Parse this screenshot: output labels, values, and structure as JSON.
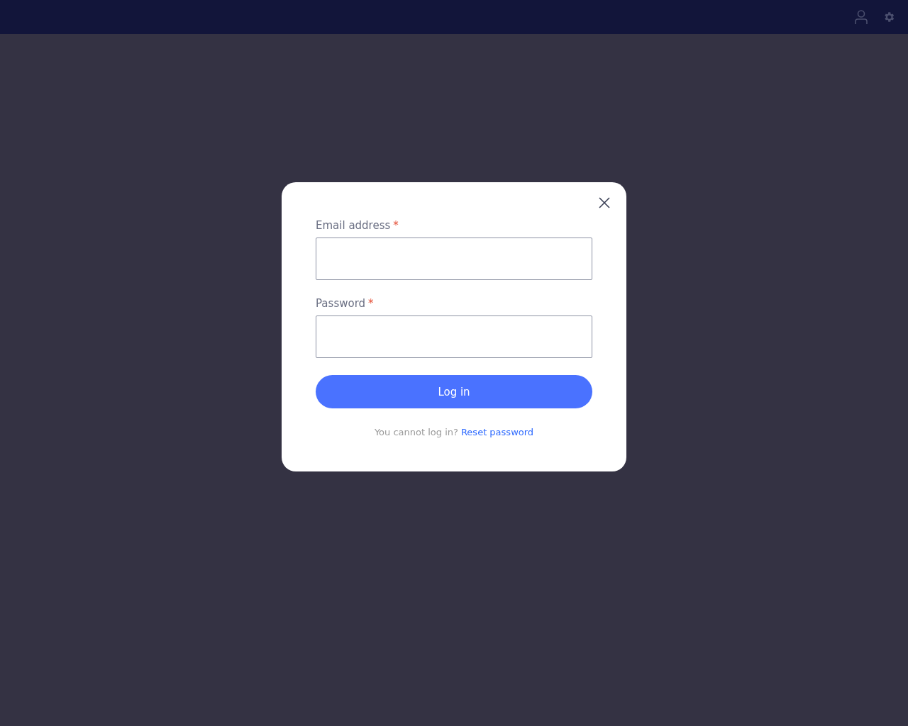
{
  "dialog": {
    "fields": [
      {
        "label": "Email address",
        "required_mark": "*"
      },
      {
        "label": "Password",
        "required_mark": "*"
      }
    ],
    "submit": "Log in",
    "help": {
      "text": "You cannot log in?",
      "link": "Reset password"
    }
  }
}
